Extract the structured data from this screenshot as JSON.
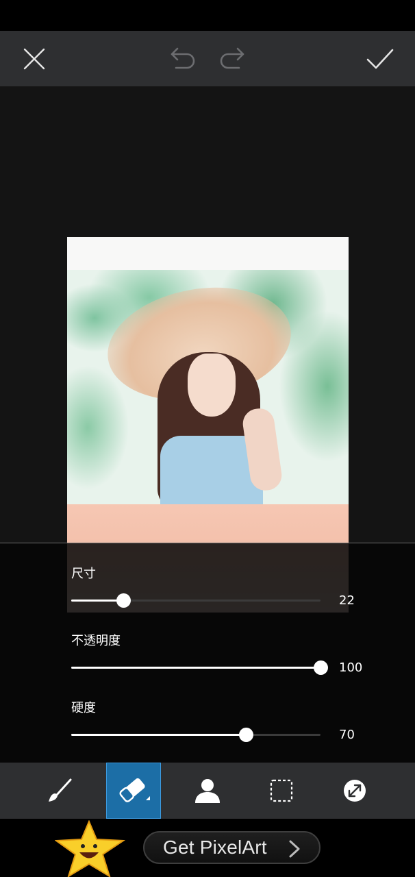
{
  "top_bar": {
    "icons": {
      "close": "close-icon",
      "undo": "undo-icon",
      "redo": "redo-icon",
      "apply": "checkmark-icon"
    }
  },
  "canvas": {
    "image": "photo of a woman in a wide straw hat and light blue top, over a peach watercolor band"
  },
  "sliders": [
    {
      "label": "尺寸",
      "value": "22",
      "level": 0.21
    },
    {
      "label": "不透明度",
      "value": "100",
      "level": 1.0
    },
    {
      "label": "硬度",
      "value": "70",
      "level": 0.7
    }
  ],
  "toolbar": {
    "tools": [
      {
        "icon": "brush-icon",
        "active": false
      },
      {
        "icon": "eraser-icon",
        "active": true
      },
      {
        "icon": "person-icon",
        "active": false
      },
      {
        "icon": "selection-icon",
        "active": false
      },
      {
        "icon": "invert-icon",
        "active": false
      }
    ]
  },
  "ad": {
    "button_label": "Get PixelArt",
    "mascot": "smiling-star-icon"
  },
  "colors": {
    "top_bar_bg": "#2e2f31",
    "canvas_bg": "#141414",
    "active_tool_bg": "#1c6ea6",
    "slider_fill": "#ffffff",
    "slider_track": "#3b3b3b"
  }
}
